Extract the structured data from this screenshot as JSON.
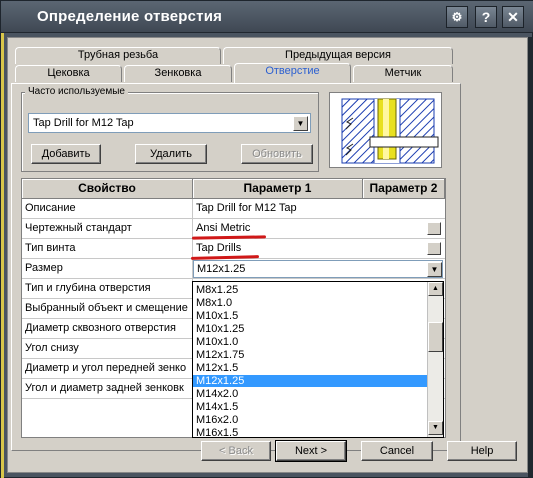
{
  "window": {
    "title": "Определение отверстия",
    "help_symbol": "?",
    "close_symbol": "✕"
  },
  "tabs_row1": [
    "Трубная резьба",
    "Предыдущая версия"
  ],
  "tabs_row2": [
    "Цековка",
    "Зенковка",
    "Отверстие",
    "Метчик"
  ],
  "active_tab": "Отверстие",
  "favorites": {
    "group_label": "Часто используемые",
    "selected": "Tap Drill for M12 Tap",
    "add_label": "Добавить",
    "delete_label": "Удалить",
    "update_label": "Обновить"
  },
  "grid": {
    "headers": [
      "Свойство",
      "Параметр 1",
      "Параметр 2"
    ],
    "rows": [
      {
        "prop": "Описание",
        "p1": "Tap Drill for M12 Tap"
      },
      {
        "prop": "Чертежный стандарт",
        "p1": "Ansi Metric"
      },
      {
        "prop": "Тип винта",
        "p1": "Tap Drills"
      },
      {
        "prop": "Размер",
        "p1": "M12x1.25"
      },
      {
        "prop": "Тип и глубина отверстия",
        "p1": ""
      },
      {
        "prop": "Выбранный объект и смещение",
        "p1": ""
      },
      {
        "prop": "Диаметр сквозного отверстия",
        "p1": ""
      },
      {
        "prop": "Угол снизу",
        "p1": ""
      },
      {
        "prop": "Диаметр и угол передней зенко",
        "p1": ""
      },
      {
        "prop": "Угол и диаметр задней зенковк",
        "p1": ""
      }
    ]
  },
  "size_list": {
    "items": [
      "M8x1.25",
      "M8x1.0",
      "M10x1.5",
      "M10x1.25",
      "M10x1.0",
      "M12x1.75",
      "M12x1.5",
      "M12x1.25",
      "M14x2.0",
      "M14x1.5",
      "M16x2.0",
      "M16x1.5"
    ],
    "selected_index": 7
  },
  "footer": {
    "back_label": "< Back",
    "next_label": "Next >",
    "cancel_label": "Cancel",
    "help_label": "Help"
  },
  "colors": {
    "selection": "#3399ff",
    "active_tab_text": "#2b5fd1",
    "highlight_underline": "#d01818",
    "bolt_yellow": "#e8e020"
  }
}
